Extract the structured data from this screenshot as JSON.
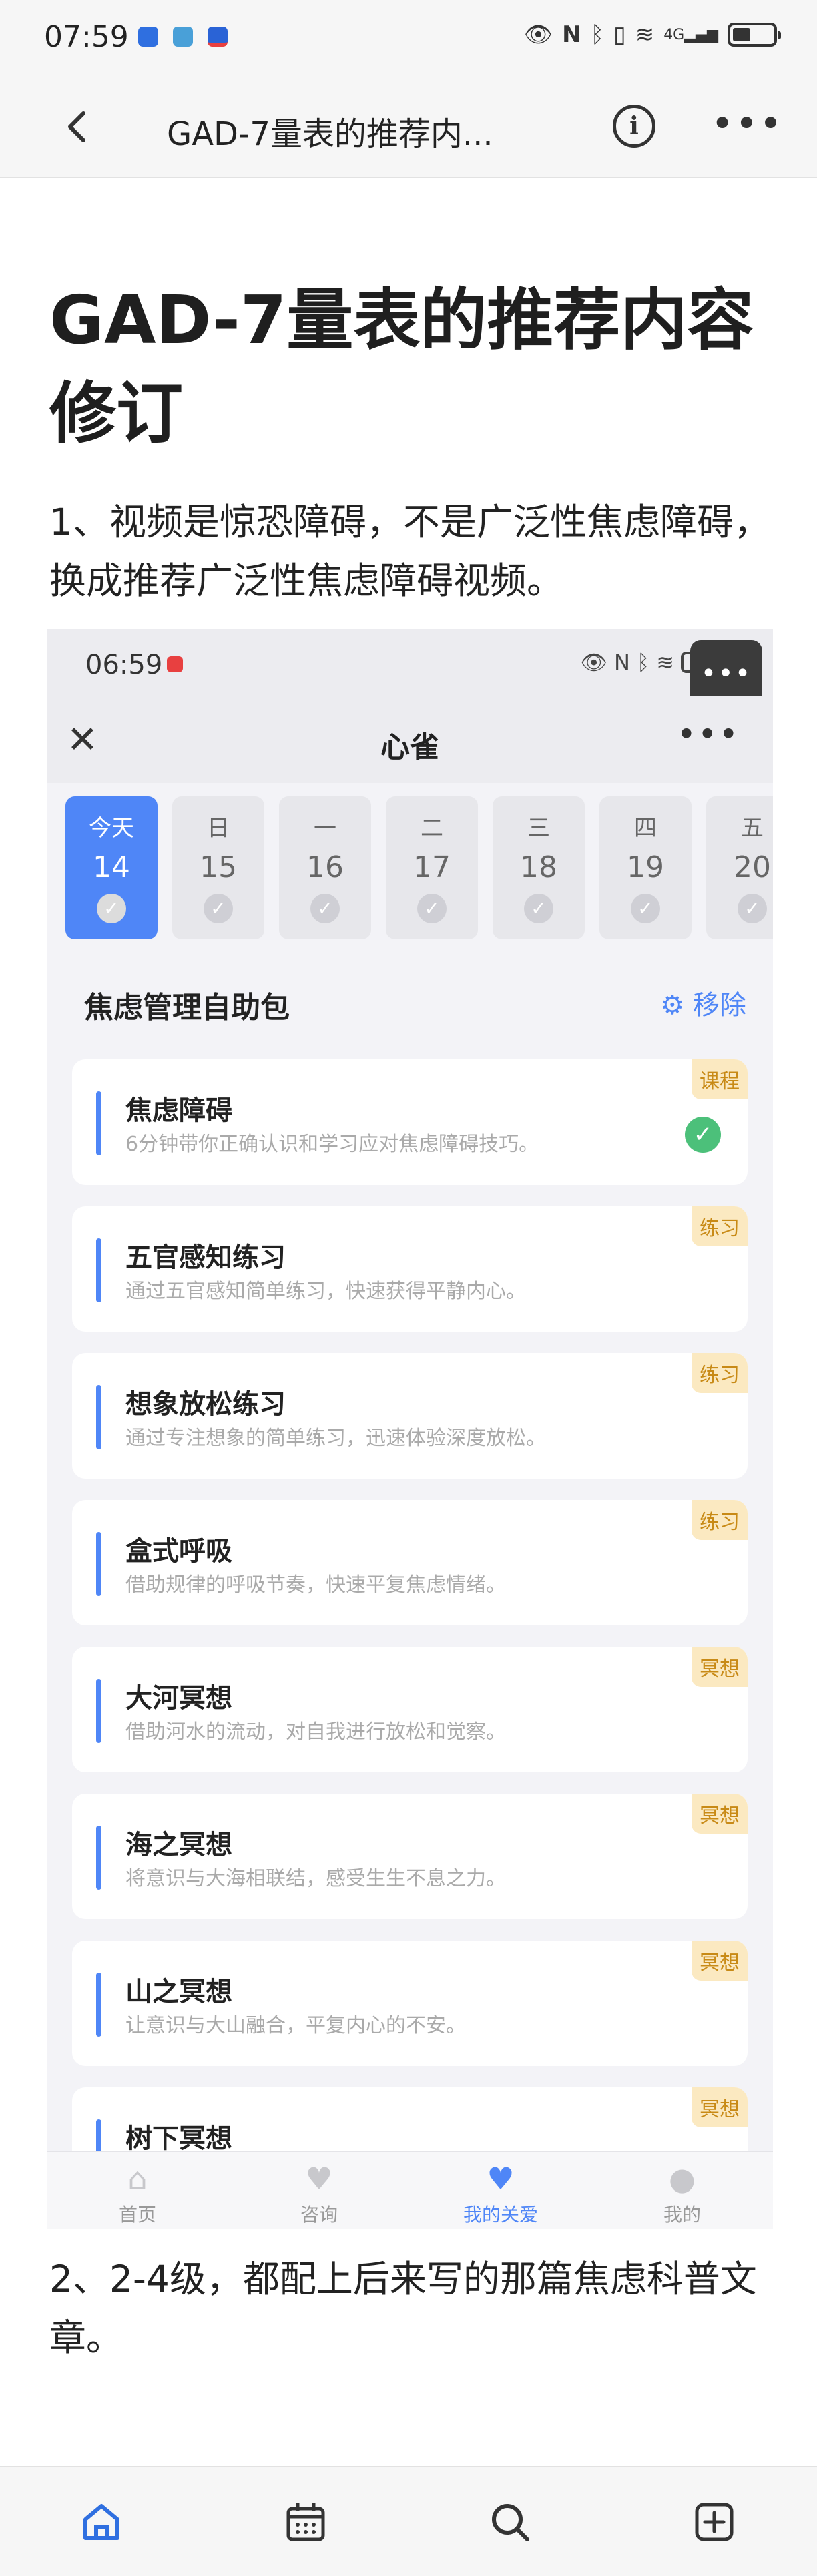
{
  "status_bar": {
    "time": "07:59",
    "network": "4G"
  },
  "nav": {
    "title": "GAD-7量表的推荐内...",
    "more": "•••"
  },
  "doc": {
    "title": "GAD-7量表的推荐内容修订",
    "para1": "1、视频是惊恐障碍，不是广泛性焦虑障碍，换成推荐广泛性焦虑障碍视频。",
    "para2": "2、2-4级，都配上后来写的那篇焦虑科普文章。"
  },
  "embed": {
    "status_time": "06:59",
    "overlay": "•••",
    "header_close": "✕",
    "header_title": "心雀",
    "header_more": "•••",
    "days": [
      {
        "name": "今天",
        "date": "14",
        "today": true
      },
      {
        "name": "日",
        "date": "15"
      },
      {
        "name": "一",
        "date": "16"
      },
      {
        "name": "二",
        "date": "17"
      },
      {
        "name": "三",
        "date": "18"
      },
      {
        "name": "四",
        "date": "19"
      },
      {
        "name": "五",
        "date": "20"
      }
    ],
    "section_title": "焦虑管理自助包",
    "section_action": "移除",
    "cards": [
      {
        "title": "焦虑障碍",
        "desc": "6分钟带你正确认识和学习应对焦虑障碍技巧。",
        "tag": "课程",
        "done": true
      },
      {
        "title": "五官感知练习",
        "desc": "通过五官感知简单练习，快速获得平静内心。",
        "tag": "练习"
      },
      {
        "title": "想象放松练习",
        "desc": "通过专注想象的简单练习，迅速体验深度放松。",
        "tag": "练习"
      },
      {
        "title": "盒式呼吸",
        "desc": "借助规律的呼吸节奏，快速平复焦虑情绪。",
        "tag": "练习"
      },
      {
        "title": "大河冥想",
        "desc": "借助河水的流动，对自我进行放松和觉察。",
        "tag": "冥想"
      },
      {
        "title": "海之冥想",
        "desc": "将意识与大海相联结，感受生生不息之力。",
        "tag": "冥想"
      },
      {
        "title": "山之冥想",
        "desc": "让意识与大山融合，平复内心的不安。",
        "tag": "冥想"
      },
      {
        "title": "树下冥想",
        "desc": "",
        "tag": "冥想"
      }
    ],
    "tabs": [
      {
        "label": "首页",
        "icon": "home-icon"
      },
      {
        "label": "咨询",
        "icon": "heart-chat-icon"
      },
      {
        "label": "我的关爱",
        "icon": "heart-icon",
        "active": true
      },
      {
        "label": "我的",
        "icon": "person-icon"
      }
    ]
  },
  "app_tabs": [
    {
      "icon": "home-icon",
      "active": true
    },
    {
      "icon": "calendar-icon"
    },
    {
      "icon": "search-icon"
    },
    {
      "icon": "add-icon"
    }
  ],
  "colors": {
    "accent": "#4f86f7",
    "tag_bg": "#fbe9c1",
    "tag_text": "#c88a16",
    "done": "#4cc07a"
  }
}
